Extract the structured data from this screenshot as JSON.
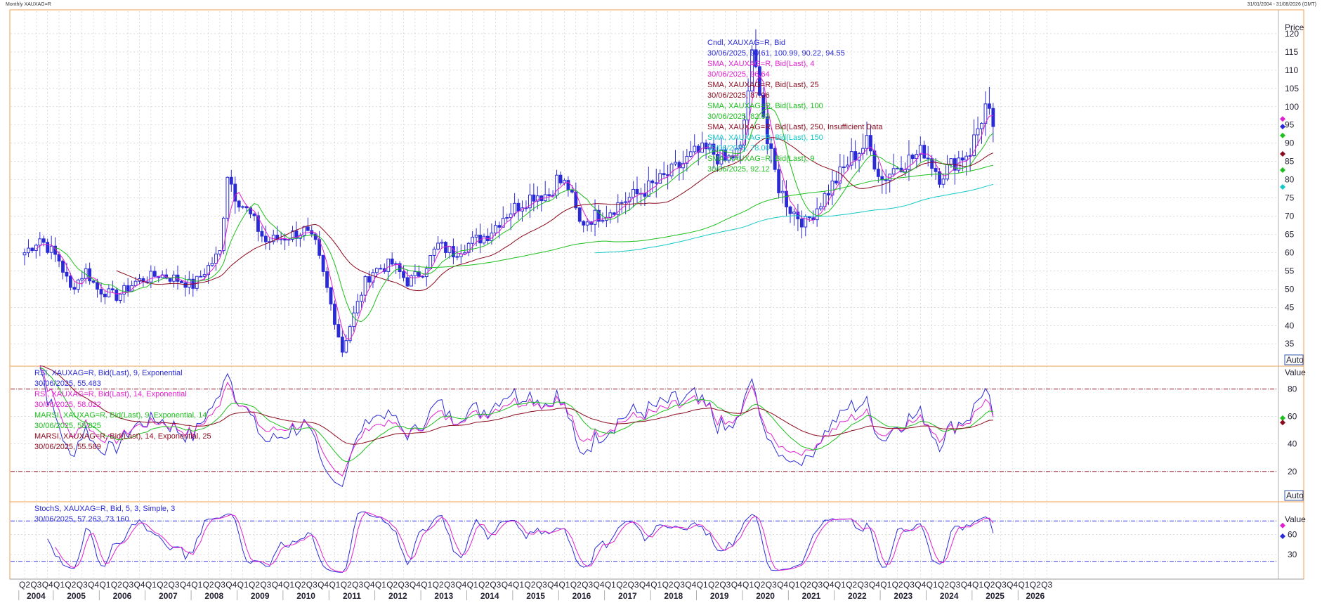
{
  "header": {
    "title": "Monthly XAUXAG=R",
    "date_range": "31/01/2004 - 31/08/2026 (GMT)"
  },
  "price_panel": {
    "axis_title": "Price",
    "ticks": [
      35,
      40,
      45,
      50,
      55,
      60,
      65,
      70,
      75,
      80,
      85,
      90,
      95,
      100,
      105,
      110,
      115,
      120
    ],
    "auto_label": "Auto",
    "legend": [
      {
        "text": "Cndl, XAUXAG=R, Bid",
        "color": "#2b2bd6"
      },
      {
        "text": "30/06/2025, 99.61, 100.99, 90.22, 94.55",
        "color": "#2b2bd6"
      },
      {
        "text": "SMA, XAUXAG=R, Bid(Last), 4",
        "color": "#e020d0"
      },
      {
        "text": "30/06/2025, 96.64",
        "color": "#e020d0"
      },
      {
        "text": "SMA, XAUXAG=R, Bid(Last), 25",
        "color": "#8b0a1e"
      },
      {
        "text": "30/06/2025, 87.06",
        "color": "#8b0a1e"
      },
      {
        "text": "SMA, XAUXAG=R, Bid(Last), 100",
        "color": "#1fbf1f"
      },
      {
        "text": "30/06/2025, 82.63",
        "color": "#1fbf1f"
      },
      {
        "text": "SMA, XAUXAG=R, Bid(Last), 250, Insufficient Data",
        "color": "#8b0a1e"
      },
      {
        "text": "SMA, XAUXAG=R, Bid(Last), 150",
        "color": "#15c8c8"
      },
      {
        "text": "30/06/2025, 78.00",
        "color": "#15c8c8"
      },
      {
        "text": "SMA, XAUXAG=R, Bid(Last), 9",
        "color": "#1fbf1f"
      },
      {
        "text": "30/06/2025, 92.12",
        "color": "#1fbf1f"
      }
    ]
  },
  "rsi_panel": {
    "ticks": [
      20,
      40,
      60,
      80
    ],
    "axis_title": "Value",
    "auto_label": "Auto",
    "legend": [
      {
        "text": "RSI, XAUXAG=R, Bid(Last), 9, Exponential",
        "color": "#2b2bd6"
      },
      {
        "text": "30/06/2025, 55.483",
        "color": "#2b2bd6"
      },
      {
        "text": "RSI, XAUXAG=R, Bid(Last), 14, Exponential",
        "color": "#e020d0"
      },
      {
        "text": "30/06/2025, 58.022",
        "color": "#e020d0"
      },
      {
        "text": "MARSI, XAUXAG=R, Bid(Last), 9, Exponential, 14",
        "color": "#1fbf1f"
      },
      {
        "text": "30/06/2025, 58.825",
        "color": "#1fbf1f"
      },
      {
        "text": "MARSI, XAUXAG=R, Bid(Last), 14, Exponential, 25",
        "color": "#8b0a1e"
      },
      {
        "text": "30/06/2025, 55.589",
        "color": "#8b0a1e"
      }
    ]
  },
  "stoch_panel": {
    "ticks": [
      30,
      60
    ],
    "axis_title": "Value",
    "legend": [
      {
        "text": "StochS, XAUXAG=R, Bid, 5, 3, Simple, 3",
        "color": "#2b2bd6"
      },
      {
        "text": "30/06/2025, 57.263, 73.160",
        "color": "#2b2bd6"
      }
    ]
  },
  "x_axis": {
    "quarters": [
      "Q2",
      "Q3",
      "Q4",
      "Q1",
      "Q2",
      "Q3",
      "Q4",
      "Q1",
      "Q2",
      "Q3",
      "Q4",
      "Q1",
      "Q2",
      "Q3",
      "Q4",
      "Q1",
      "Q2",
      "Q3",
      "Q4",
      "Q1",
      "Q2",
      "Q3",
      "Q4",
      "Q1",
      "Q2",
      "Q3",
      "Q4",
      "Q1",
      "Q2",
      "Q3",
      "Q4",
      "Q1",
      "Q2",
      "Q3",
      "Q4",
      "Q1",
      "Q2",
      "Q3",
      "Q4",
      "Q1",
      "Q2",
      "Q3",
      "Q4",
      "Q1",
      "Q2",
      "Q3",
      "Q4",
      "Q1",
      "Q2",
      "Q3",
      "Q4",
      "Q1",
      "Q2",
      "Q3",
      "Q4",
      "Q1",
      "Q2",
      "Q3",
      "Q4",
      "Q1",
      "Q2",
      "Q3",
      "Q4",
      "Q1",
      "Q2",
      "Q3",
      "Q4",
      "Q1",
      "Q2",
      "Q3",
      "Q4",
      "Q1",
      "Q2",
      "Q3",
      "Q4",
      "Q1",
      "Q2",
      "Q3",
      "Q4",
      "Q1",
      "Q2",
      "Q3",
      "Q4",
      "Q1",
      "Q2",
      "Q3",
      "Q4",
      "Q1",
      "Q2",
      "Q3"
    ],
    "years": [
      "2004",
      "2005",
      "2006",
      "2007",
      "2008",
      "2009",
      "2010",
      "2011",
      "2012",
      "2013",
      "2014",
      "2015",
      "2016",
      "2017",
      "2018",
      "2019",
      "2020",
      "2021",
      "2022",
      "2023",
      "2024",
      "2025",
      "2026"
    ]
  },
  "colors": {
    "candle": "#2b2bd6",
    "sma4": "#e020d0",
    "sma25": "#8b0a1e",
    "sma100": "#1fbf1f",
    "sma150": "#15c8c8",
    "sma9": "#1fbf1f",
    "panel_border": "#f0a050",
    "grid": "#c8c8c8",
    "ref_line": "#8b0a1e",
    "stoch_ref": "#3a3ae0"
  },
  "chart_data": [
    {
      "type": "candlestick",
      "title": "Cndl, XAUXAG=R, Bid",
      "ylabel": "Price",
      "ylim": [
        31,
        125
      ],
      "x_start": "2004-05",
      "x_end": "2025-06",
      "anchors": [
        [
          "2004-05",
          60
        ],
        [
          "2004-09",
          64
        ],
        [
          "2005-02",
          58
        ],
        [
          "2005-05",
          50
        ],
        [
          "2005-09",
          55
        ],
        [
          "2005-12",
          50
        ],
        [
          "2006-05",
          48
        ],
        [
          "2006-10",
          52
        ],
        [
          "2007-04",
          54
        ],
        [
          "2007-08",
          53
        ],
        [
          "2008-01",
          51
        ],
        [
          "2008-08",
          60
        ],
        [
          "2008-10",
          82
        ],
        [
          "2008-12",
          76
        ],
        [
          "2009-04",
          70
        ],
        [
          "2009-08",
          63
        ],
        [
          "2009-12",
          64
        ],
        [
          "2010-06",
          66
        ],
        [
          "2010-09",
          62
        ],
        [
          "2010-12",
          50
        ],
        [
          "2011-04",
          33
        ],
        [
          "2011-06",
          40
        ],
        [
          "2011-10",
          52
        ],
        [
          "2011-12",
          55
        ],
        [
          "2012-05",
          57
        ],
        [
          "2012-09",
          52
        ],
        [
          "2013-01",
          55
        ],
        [
          "2013-05",
          62
        ],
        [
          "2013-09",
          60
        ],
        [
          "2014-02",
          63
        ],
        [
          "2014-06",
          65
        ],
        [
          "2014-10",
          70
        ],
        [
          "2015-02",
          73
        ],
        [
          "2015-06",
          76
        ],
        [
          "2015-10",
          76
        ],
        [
          "2015-12",
          80
        ],
        [
          "2016-03",
          78
        ],
        [
          "2016-06",
          68
        ],
        [
          "2016-10",
          70
        ],
        [
          "2017-01",
          71
        ],
        [
          "2017-05",
          74
        ],
        [
          "2017-09",
          76
        ],
        [
          "2018-02",
          79
        ],
        [
          "2018-06",
          82
        ],
        [
          "2018-12",
          87
        ],
        [
          "2019-04",
          88
        ],
        [
          "2019-08",
          85
        ],
        [
          "2019-12",
          88
        ],
        [
          "2020-03",
          113
        ],
        [
          "2020-05",
          106
        ],
        [
          "2020-07",
          90
        ],
        [
          "2020-10",
          78
        ],
        [
          "2021-01",
          72
        ],
        [
          "2021-05",
          68
        ],
        [
          "2021-09",
          74
        ],
        [
          "2022-01",
          80
        ],
        [
          "2022-05",
          86
        ],
        [
          "2022-09",
          90
        ],
        [
          "2023-01",
          80
        ],
        [
          "2023-05",
          84
        ],
        [
          "2023-09",
          86
        ],
        [
          "2023-12",
          88
        ],
        [
          "2024-04",
          81
        ],
        [
          "2024-08",
          85
        ],
        [
          "2024-12",
          88
        ],
        [
          "2025-04",
          100
        ],
        [
          "2025-06",
          94.55
        ]
      ],
      "last_candle": {
        "date": "30/06/2025",
        "open": 99.61,
        "high": 100.99,
        "low": 90.22,
        "close": 94.55
      },
      "series": [
        {
          "name": "SMA, XAUXAG=R, Bid(Last), 4",
          "last": 96.64
        },
        {
          "name": "SMA, XAUXAG=R, Bid(Last), 25",
          "last": 87.06
        },
        {
          "name": "SMA, XAUXAG=R, Bid(Last), 100",
          "last": 82.63
        },
        {
          "name": "SMA, XAUXAG=R, Bid(Last), 150",
          "last": 78.0
        },
        {
          "name": "SMA, XAUXAG=R, Bid(Last), 9",
          "last": 92.12
        }
      ]
    },
    {
      "type": "line",
      "title": "RSI, XAUXAG=R, Bid(Last), 9, Exponential",
      "ylim": [
        0,
        93
      ],
      "reference_lines": [
        20,
        80
      ],
      "series": [
        {
          "name": "RSI, XAUXAG=R, Bid(Last), 9, Exponential",
          "last": 55.483
        },
        {
          "name": "RSI, XAUXAG=R, Bid(Last), 14, Exponential",
          "last": 58.022
        },
        {
          "name": "MARSI, XAUXAG=R, Bid(Last), 9, Exponential, 14",
          "last": 58.825
        },
        {
          "name": "MARSI, XAUXAG=R, Bid(Last), 14, Exponential, 25",
          "last": 55.589
        }
      ]
    },
    {
      "type": "line",
      "title": "StochS, XAUXAG=R, Bid, 5, 3, Simple, 3",
      "ylim": [
        0,
        100
      ],
      "reference_lines": [
        20,
        80
      ],
      "series": [
        {
          "name": "StochS %K",
          "last": 57.263
        },
        {
          "name": "StochS %D",
          "last": 73.16
        }
      ]
    }
  ]
}
